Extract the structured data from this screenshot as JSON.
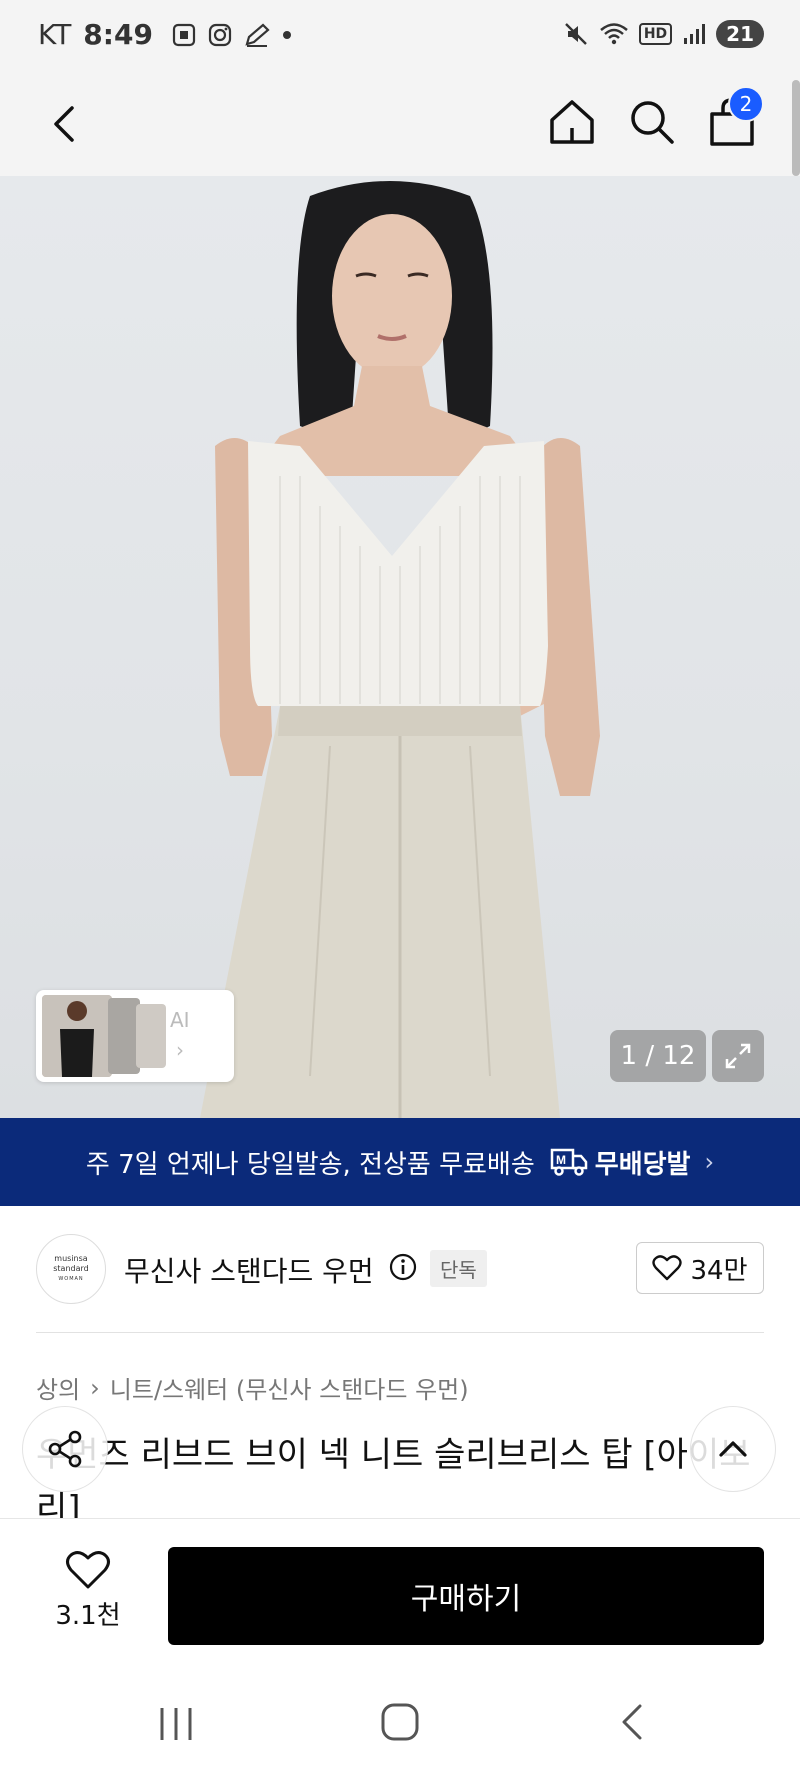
{
  "status_bar": {
    "carrier": "KT",
    "time": "8:49",
    "hd_label": "HD",
    "battery": "21"
  },
  "header": {
    "cart_count": "2"
  },
  "hero": {
    "page_counter": "1 / 12",
    "thumb_ai_label": "AI"
  },
  "banner": {
    "text": "주 7일 언제나 당일발송, 전상품 무료배송",
    "brand_label": "무배당발",
    "brand_mark": "M"
  },
  "brand": {
    "logo_line1": "musinsa",
    "logo_line2": "standard",
    "logo_line3": "WOMAN",
    "name": "무신사 스탠다드 우먼",
    "badge": "단독",
    "likes": "34만"
  },
  "breadcrumb": {
    "category": "상의",
    "subcategory": "니트/스웨터 (무신사 스탠다드 우먼)"
  },
  "product": {
    "title": "우먼즈 리브드 브이 넥 니트 슬리브리스 탑 [아이보리]"
  },
  "bottom_bar": {
    "wish_count": "3.1천",
    "buy_label": "구매하기"
  },
  "colors": {
    "banner_bg": "#0b2a7a",
    "cart_badge": "#1a5cff",
    "buy_button": "#000000"
  }
}
